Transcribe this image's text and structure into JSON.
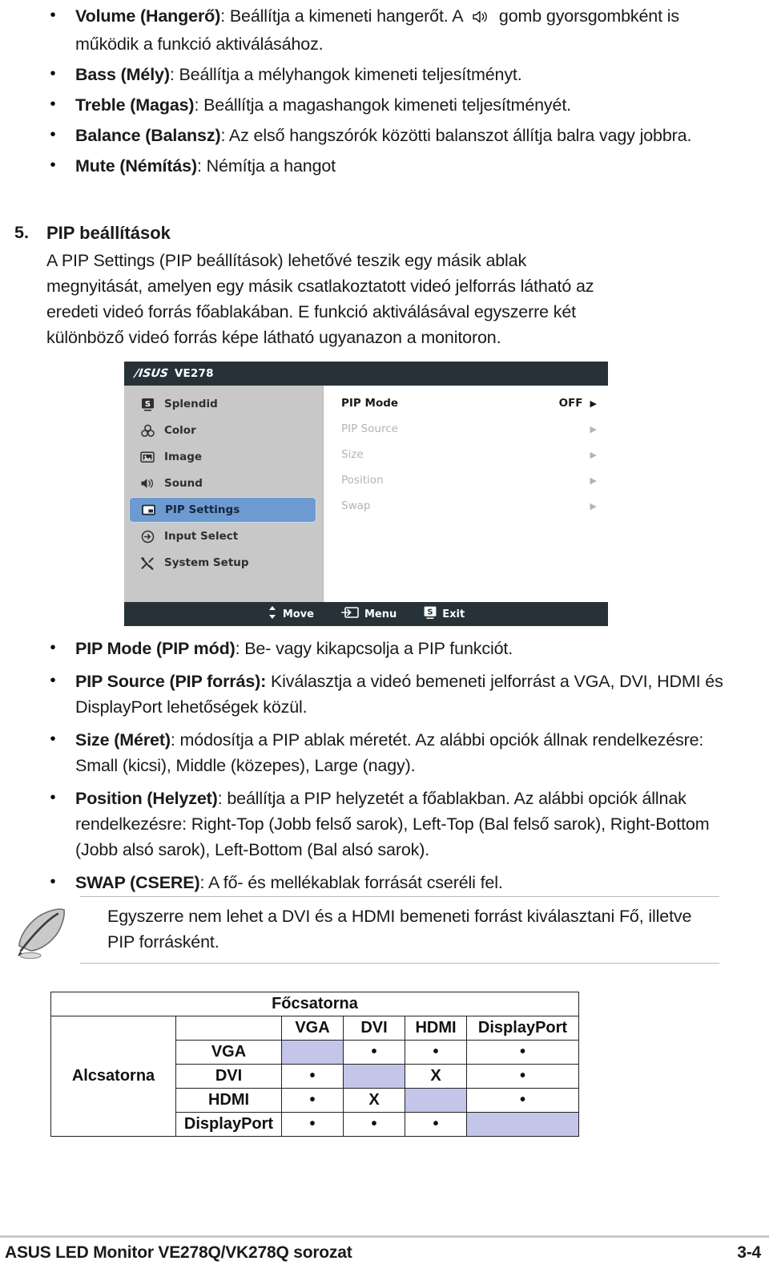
{
  "top_bullets": [
    {
      "term": "Volume (Hangerő)",
      "text_before_icon": ": Beállítja a kimeneti hangerőt. A ",
      "icon": "speaker-icon",
      "text_after_icon": " gomb gyorsgombként is működik a funkció aktiválásához."
    },
    {
      "term": "Bass (Mély)",
      "text": ": Beállítja a mélyhangok kimeneti teljesítményt."
    },
    {
      "term": "Treble (Magas)",
      "text": ": Beállítja a magashangok kimeneti teljesítményét."
    },
    {
      "term": "Balance (Balansz)",
      "text": ": Az első hangszórók közötti balanszot állítja balra vagy jobbra."
    },
    {
      "term": "Mute (Némítás)",
      "text": ": Némítja a hangot"
    }
  ],
  "section_five": {
    "number": "5.",
    "title": "PIP beállítások",
    "paragraph": "A PIP Settings (PIP beállítások) lehetővé teszik egy másik ablak megnyitását, amelyen egy másik csatlakoztatott videó jelforrás látható az eredeti videó forrás főablakában. E funkció aktiválásával egyszerre két különböző videó forrás képe látható ugyanazon a monitoron."
  },
  "osd": {
    "brand": "/ISUS",
    "model": "VE278",
    "menu_items": [
      {
        "label": "Splendid",
        "icon": "splendid-icon",
        "active": false
      },
      {
        "label": "Color",
        "icon": "color-icon",
        "active": false
      },
      {
        "label": "Image",
        "icon": "image-icon",
        "active": false
      },
      {
        "label": "Sound",
        "icon": "sound-icon",
        "active": false
      },
      {
        "label": "PIP Settings",
        "icon": "pip-settings-icon",
        "active": true
      },
      {
        "label": "Input Select",
        "icon": "input-select-icon",
        "active": false
      },
      {
        "label": "System Setup",
        "icon": "system-setup-icon",
        "active": false
      }
    ],
    "options": [
      {
        "label": "PIP Mode",
        "value": "OFF",
        "selected": true
      },
      {
        "label": "PIP Source",
        "value": "",
        "selected": false
      },
      {
        "label": "Size",
        "value": "",
        "selected": false
      },
      {
        "label": "Position",
        "value": "",
        "selected": false
      },
      {
        "label": "Swap",
        "value": "",
        "selected": false
      }
    ],
    "footer": [
      {
        "label": "Move",
        "icon": "up-down-arrows-icon"
      },
      {
        "label": "Menu",
        "icon": "menu-enter-icon"
      },
      {
        "label": "Exit",
        "icon": "splendid-s-icon"
      }
    ],
    "colors": {
      "header_bg": "#263238",
      "sidebar_bg": "#c8c8c8",
      "highlight": "#6d9bd1",
      "panel_bg": "#ffffff",
      "dim_text": "#b4b4b4"
    }
  },
  "lower_bullets": [
    {
      "term": "PIP Mode (PIP mód)",
      "text": ": Be- vagy kikapcsolja a PIP funkciót."
    },
    {
      "term": "PIP Source (PIP forrás):",
      "text": " Kiválasztja a videó bemeneti jelforrást a VGA, DVI, HDMI és DisplayPort lehetőségek közül."
    },
    {
      "term": "Size (Méret)",
      "text": ": módosítja a PIP ablak méretét. Az alábbi opciók állnak rendelkezésre: Small (kicsi), Middle (közepes), Large (nagy)."
    },
    {
      "term": "Position (Helyzet)",
      "text": ": beállítja a PIP helyzetét a főablakban. Az alábbi opciók állnak rendelkezésre: Right-Top (Jobb felső sarok), Left-Top (Bal felső sarok), Right-Bottom (Jobb alsó sarok), Left-Bottom (Bal alsó sarok)."
    },
    {
      "term": "SWAP (CSERE)",
      "text": ": A fő- és mellékablak forrását cseréli fel."
    }
  ],
  "note": {
    "icon": "quill-pen-icon",
    "text": "Egyszerre nem lehet a DVI és a HDMI bemeneti forrást kiválasztani Fő, illetve PIP forrásként."
  },
  "compat_table": {
    "main_header": "Főcsatorna",
    "side_header": "Alcsatorna",
    "columns": [
      "VGA",
      "DVI",
      "HDMI",
      "DisplayPort"
    ],
    "rows": [
      {
        "label": "VGA",
        "cells": [
          "fill",
          "dot",
          "dot",
          "dot"
        ]
      },
      {
        "label": "DVI",
        "cells": [
          "dot",
          "fill",
          "X",
          "dot"
        ]
      },
      {
        "label": "HDMI",
        "cells": [
          "dot",
          "X",
          "fill",
          "dot"
        ]
      },
      {
        "label": "DisplayPort",
        "cells": [
          "dot",
          "dot",
          "dot",
          "fill"
        ]
      }
    ],
    "fill_color": "#c3c6e8"
  },
  "page_footer": {
    "left": "ASUS LED Monitor VE278Q/VK278Q sorozat",
    "right": "3-4"
  }
}
